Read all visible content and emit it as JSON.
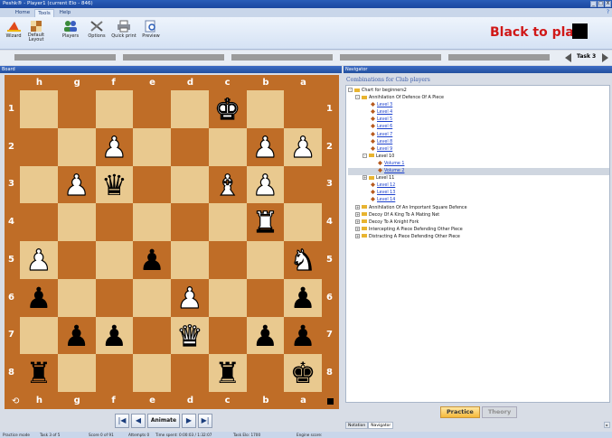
{
  "window": {
    "title": "Peshk® - Player1 (current Elo - 846)",
    "controls": [
      "_",
      "□",
      "X"
    ]
  },
  "menu": {
    "tabs": [
      "Home",
      "Tools",
      "Help"
    ],
    "active": "Tools",
    "help_glyph": "?"
  },
  "ribbon": {
    "buttons": [
      {
        "label": "Wizard",
        "icon": "wizard-hat-icon"
      },
      {
        "label": "Default Layout",
        "icon": "layout-icon"
      },
      {
        "label": "Players",
        "icon": "players-icon"
      },
      {
        "label": "Options",
        "icon": "tools-icon"
      },
      {
        "label": "Quick print",
        "icon": "printer-icon"
      },
      {
        "label": "Preview",
        "icon": "preview-icon"
      }
    ]
  },
  "turn": {
    "text": "Black to play",
    "color": "#d01818",
    "square_color": "#000000"
  },
  "task": {
    "label": "Task 3"
  },
  "board_panel": {
    "title": "Board"
  },
  "board": {
    "files": [
      "h",
      "g",
      "f",
      "e",
      "d",
      "c",
      "b",
      "a"
    ],
    "ranks": [
      "1",
      "2",
      "3",
      "4",
      "5",
      "6",
      "7",
      "8"
    ],
    "light_color": "#e9c98f",
    "dark_color": "#bf6d27",
    "pieces": [
      {
        "square": "c1",
        "glyph": "♚",
        "color": "white"
      },
      {
        "square": "f2",
        "glyph": "♟",
        "color": "white"
      },
      {
        "square": "b2",
        "glyph": "♟",
        "color": "white"
      },
      {
        "square": "a2",
        "glyph": "♟",
        "color": "white"
      },
      {
        "square": "g3",
        "glyph": "♟",
        "color": "white"
      },
      {
        "square": "f3",
        "glyph": "♛",
        "color": "black"
      },
      {
        "square": "c3",
        "glyph": "♝",
        "color": "white"
      },
      {
        "square": "b3",
        "glyph": "♟",
        "color": "white"
      },
      {
        "square": "b4",
        "glyph": "♜",
        "color": "white"
      },
      {
        "square": "h5",
        "glyph": "♟",
        "color": "white"
      },
      {
        "square": "e5",
        "glyph": "♟",
        "color": "black"
      },
      {
        "square": "a5",
        "glyph": "♞",
        "color": "white"
      },
      {
        "square": "h6",
        "glyph": "♟",
        "color": "black"
      },
      {
        "square": "d6",
        "glyph": "♟",
        "color": "white"
      },
      {
        "square": "a6",
        "glyph": "♟",
        "color": "black"
      },
      {
        "square": "g7",
        "glyph": "♟",
        "color": "black"
      },
      {
        "square": "f7",
        "glyph": "♟",
        "color": "black"
      },
      {
        "square": "d7",
        "glyph": "♛",
        "color": "white"
      },
      {
        "square": "b7",
        "glyph": "♟",
        "color": "black"
      },
      {
        "square": "a7",
        "glyph": "♟",
        "color": "black"
      },
      {
        "square": "h8",
        "glyph": "♜",
        "color": "black"
      },
      {
        "square": "c8",
        "glyph": "♜",
        "color": "black"
      },
      {
        "square": "a8",
        "glyph": "♚",
        "color": "black"
      }
    ]
  },
  "controls": {
    "first": "|◀",
    "prev": "◀",
    "animate": "Animate",
    "next": "▶",
    "last": "▶|"
  },
  "navigator": {
    "panel_title": "Navigator",
    "heading": "Combinations for Club players",
    "tree": [
      {
        "label": "Chart for beginners2",
        "depth": 0,
        "kind": "folder",
        "toggle": "-"
      },
      {
        "label": "Annihilation Of Defence Of A Piece",
        "depth": 1,
        "kind": "folder",
        "toggle": "-"
      },
      {
        "label": "Level 3",
        "depth": 2,
        "kind": "task",
        "link": true
      },
      {
        "label": "Level 4",
        "depth": 2,
        "kind": "task",
        "link": true
      },
      {
        "label": "Level 5",
        "depth": 2,
        "kind": "task",
        "link": true
      },
      {
        "label": "Level 6",
        "depth": 2,
        "kind": "task",
        "link": true
      },
      {
        "label": "Level 7",
        "depth": 2,
        "kind": "task",
        "link": true
      },
      {
        "label": "Level 8",
        "depth": 2,
        "kind": "task",
        "link": true
      },
      {
        "label": "Level 9",
        "depth": 2,
        "kind": "task",
        "link": true
      },
      {
        "label": "Level 10",
        "depth": 2,
        "kind": "folder",
        "toggle": "-"
      },
      {
        "label": "Volume 1",
        "depth": 3,
        "kind": "task",
        "link": true
      },
      {
        "label": "Volume 2",
        "depth": 3,
        "kind": "task",
        "link": true,
        "selected": true
      },
      {
        "label": "Level 11",
        "depth": 2,
        "kind": "folder",
        "toggle": "+"
      },
      {
        "label": "Level 12",
        "depth": 2,
        "kind": "task",
        "link": true
      },
      {
        "label": "Level 13",
        "depth": 2,
        "kind": "task",
        "link": true
      },
      {
        "label": "Level 14",
        "depth": 2,
        "kind": "task",
        "link": true
      },
      {
        "label": "Annihilation Of An Important Square Defence",
        "depth": 1,
        "kind": "folder",
        "toggle": "+"
      },
      {
        "label": "Decoy Of A King To A Mating Net",
        "depth": 1,
        "kind": "folder",
        "toggle": "+"
      },
      {
        "label": "Decoy To A Knight Fork",
        "depth": 1,
        "kind": "folder",
        "toggle": "+"
      },
      {
        "label": "Intercepting A Piece Defending Other Piece",
        "depth": 1,
        "kind": "folder",
        "toggle": "+"
      },
      {
        "label": "Distracting A Piece Defending Other Piece",
        "depth": 1,
        "kind": "folder",
        "toggle": "+"
      }
    ],
    "practice_label": "Practice",
    "theory_label": "Theory",
    "tabs": [
      "Notation",
      "Navigator"
    ],
    "active_tab": "Navigator"
  },
  "status": {
    "mode": "Practice mode",
    "task": "Task 3 of 5",
    "score": "Score 0 of 91",
    "attempts": "Attempts 0",
    "time_spent": "Time spent: 0:00:03 / 1:32:07",
    "task_elo": "Task Elo: 1700",
    "engine_score": "Engine score:"
  }
}
